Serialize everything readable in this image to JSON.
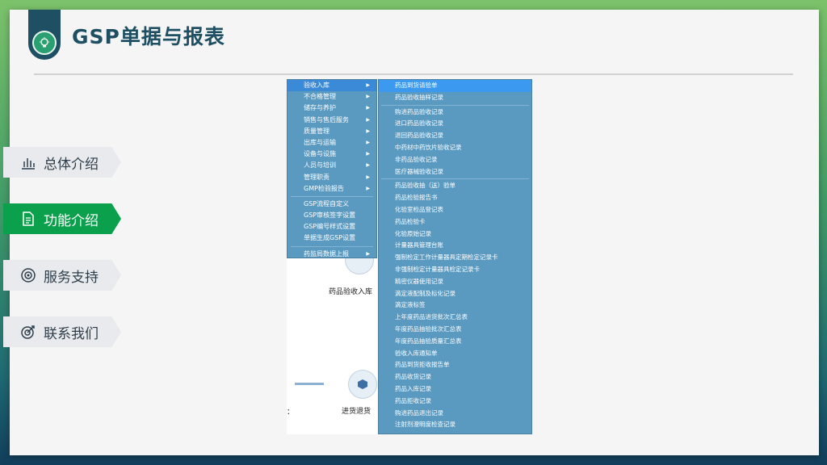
{
  "slide": {
    "title": "GSP单据与报表"
  },
  "nav": [
    {
      "label": "总体介绍",
      "icon": "bar-chart-icon",
      "active": false
    },
    {
      "label": "功能介绍",
      "icon": "document-icon",
      "active": true
    },
    {
      "label": "服务支持",
      "icon": "target-icon",
      "active": false
    },
    {
      "label": "联系我们",
      "icon": "target-arrow-icon",
      "active": false
    }
  ],
  "screenshot": {
    "menu_main": [
      {
        "label": "验收入库",
        "submenu": true
      },
      {
        "label": "不合格管理",
        "submenu": true
      },
      {
        "label": "储存与养护",
        "submenu": true
      },
      {
        "label": "销售与售后服务",
        "submenu": true
      },
      {
        "label": "质量管理",
        "submenu": true
      },
      {
        "label": "出库与运输",
        "submenu": true
      },
      {
        "label": "设备与设施",
        "submenu": true
      },
      {
        "label": "人员与培训",
        "submenu": true
      },
      {
        "label": "管理职责",
        "submenu": true
      },
      {
        "label": "GMP检验报告",
        "submenu": true
      },
      {
        "label": "GSP流程自定义",
        "submenu": false
      },
      {
        "label": "GSP审核签字设置",
        "submenu": false
      },
      {
        "label": "GSP编号样式设置",
        "submenu": false
      },
      {
        "label": "单据生成GSP设置",
        "submenu": false
      },
      {
        "label": "药监局数据上报",
        "submenu": true
      }
    ],
    "submenu_group1": [
      "药品到货请验单",
      "药品验收抽样记录"
    ],
    "submenu_group2": [
      "购进药品验收记录",
      "进口药品验收记录",
      "退回药品验收记录",
      "中药材中药饮片验收记录",
      "非药品验收记录",
      "医疗器械验收记录"
    ],
    "submenu_group3": [
      "药品验收抽（送）验单",
      "药品检验报告书",
      "化验室检品登记表",
      "药品检验卡",
      "化验原始记录",
      "计量器具管理台账",
      "强制检定工作计量器具定期检定记录卡",
      "非强制检定计量器具检定记录卡",
      "精密仪器使用记录",
      "滴定液配制及标化记录",
      "滴定液标签",
      "上年度药品进货批次汇总表",
      "年度药品抽验批次汇总表",
      "年度药品抽验质量汇总表",
      "验收入库通知单",
      "药品到货拒收报告单",
      "药品收货记录",
      "药品入库记录",
      "药品拒收记录",
      "购进药品退出记录",
      "注射剂澄明度检查记录"
    ],
    "bg_label_1": "药品验收入库",
    "bg_label_2": "进货退货",
    "bg_label_3": "："
  }
}
